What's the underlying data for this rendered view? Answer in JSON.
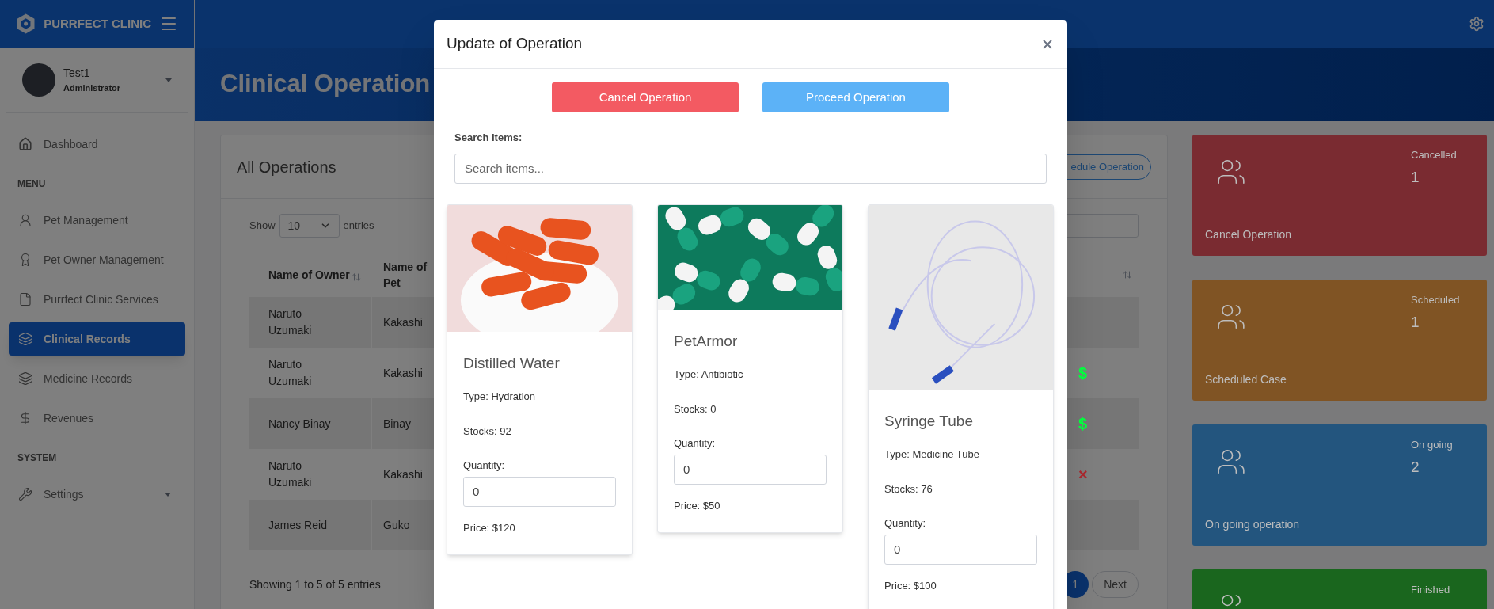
{
  "brand": "PURRFECT CLINIC",
  "user": {
    "name": "Test1",
    "role": "Administrator"
  },
  "sidebar": {
    "items": [
      {
        "kind": "link",
        "label": "Dashboard",
        "selected": false,
        "has_submenu": false
      },
      {
        "kind": "heading",
        "label": "MENU"
      },
      {
        "kind": "link",
        "label": "Pet Management",
        "selected": false,
        "has_submenu": false
      },
      {
        "kind": "link",
        "label": "Pet Owner Management",
        "selected": false,
        "has_submenu": false
      },
      {
        "kind": "link",
        "label": "Purrfect Clinic Services",
        "selected": false,
        "has_submenu": false
      },
      {
        "kind": "link",
        "label": "Clinical Records",
        "selected": true,
        "has_submenu": false
      },
      {
        "kind": "link",
        "label": "Medicine Records",
        "selected": false,
        "has_submenu": false
      },
      {
        "kind": "link",
        "label": "Revenues",
        "selected": false,
        "has_submenu": false
      },
      {
        "kind": "heading",
        "label": "SYSTEM"
      },
      {
        "kind": "link",
        "label": "Settings",
        "selected": false,
        "has_submenu": true
      }
    ]
  },
  "page_title": "Clinical Operation",
  "operations": {
    "title": "All Operations",
    "schedule_button": "edule Operation",
    "length": {
      "before": "Show",
      "value": "10",
      "after": "entries"
    },
    "columns": [
      "Name of Owner",
      "Name of Pet"
    ],
    "rows": [
      {
        "cells": [
          "Naruto Uzumaki",
          "Kakashi"
        ]
      },
      {
        "cells": [
          "Naruto Uzumaki",
          "Kakashi"
        ],
        "action": {
          "text": "$",
          "color": "#00ff3c"
        }
      },
      {
        "cells": [
          "Nancy Binay",
          "Binay"
        ],
        "action": {
          "text": "$",
          "color": "#00ff3c"
        }
      },
      {
        "cells": [
          "Naruto Uzumaki",
          "Kakashi"
        ],
        "action": {
          "text": "×",
          "color": "#a8262d"
        }
      },
      {
        "cells": [
          "James Reid",
          "Guko"
        ]
      }
    ],
    "info": "Showing 1 to 5 of 5 entries",
    "pages": [
      {
        "label": "1",
        "selected": true
      },
      {
        "label": "Next",
        "selected": false
      }
    ]
  },
  "stats": [
    {
      "label": "Cancel Operation",
      "status": "Cancelled",
      "count": "1",
      "color": "#7a2b31"
    },
    {
      "label": "Scheduled Case",
      "status": "Scheduled",
      "count": "1",
      "color": "#805424"
    },
    {
      "label": "On going operation",
      "status": "On going",
      "count": "2",
      "color": "#23557e"
    },
    {
      "status": "Finished",
      "color": "#1a661e"
    }
  ],
  "modal": {
    "title": "Update of Operation",
    "buttons": [
      {
        "label": "Cancel Operation",
        "kind": "danger"
      },
      {
        "label": "Proceed Operation",
        "kind": "primary"
      }
    ],
    "search": {
      "label": "Search Items:",
      "placeholder": "Search items..."
    },
    "items": [
      {
        "name": "Distilled Water",
        "type": "Type: Hydration",
        "stocks": "Stocks: 92",
        "quantity_label": "Quantity:",
        "quantity": "0",
        "price": "Price: $120"
      },
      {
        "name": "PetArmor",
        "type": "Type: Antibiotic",
        "stocks": "Stocks: 0",
        "quantity_label": "Quantity:",
        "quantity": "0",
        "price": "Price: $50"
      },
      {
        "name": "Syringe Tube",
        "type": "Type: Medicine Tube",
        "stocks": "Stocks: 76",
        "quantity_label": "Quantity:",
        "quantity": "0",
        "price": "Price: $100"
      }
    ]
  }
}
